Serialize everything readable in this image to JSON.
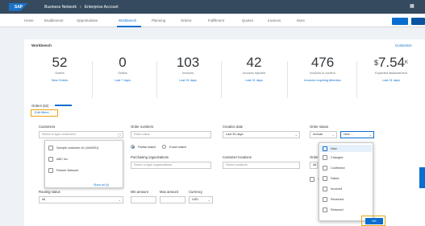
{
  "shell": {
    "logo": "SAP",
    "breadcrumbs": [
      "Business Network",
      "›",
      "Enterprise Account"
    ],
    "menu_icon": "grid-icon"
  },
  "nav": {
    "tabs": [
      "Home",
      "Enablement",
      "Opportunities",
      "Workbench",
      "Planning",
      "Orders",
      "Fulfillment",
      "Quotes",
      "Invoices",
      "More"
    ],
    "active_tab": "Workbench"
  },
  "card": {
    "title": "Workbench",
    "customize": "Customize",
    "kpis": [
      {
        "value": "52",
        "label": "Orders",
        "link": "New Orders"
      },
      {
        "value": "0",
        "label": "Orders",
        "link": "Last 7 days"
      },
      {
        "value": "103",
        "label": "Invoices",
        "link": "Last 31 days"
      },
      {
        "value": "42",
        "label": "Invoices rejected",
        "link": "Last 31 days"
      },
      {
        "value": "476",
        "label": "Invoices to confirm",
        "link": "Invoices requiring Attention"
      },
      {
        "value": "7.54",
        "label": "Expected disbursement",
        "link": "Last 31 days",
        "unit": "K",
        "prefix": "$"
      }
    ],
    "filters_head": "Orders (52)",
    "filters_chip": "Edit filters"
  },
  "form": {
    "customer": {
      "label": "Customers",
      "placeholder": "Select or type customers"
    },
    "customer_options": [
      "Sample customer A1 (AN0001)",
      "ABC Inc",
      "Partner Network"
    ],
    "show_all": "Show all (4)",
    "order_numbers": {
      "label": "Order numbers",
      "placeholder": "Exact value"
    },
    "match_exact": "Partial match",
    "exact_match": "Exact match",
    "creation_date": {
      "label": "Creation date",
      "value": "Last 30 days"
    },
    "order_status": {
      "label": "Order status",
      "value": "Include",
      "value2": "New",
      "value3": "…"
    },
    "purchasing_org": {
      "label": "Purchasing organizations",
      "placeholder": "Select or type organizations"
    },
    "customer_location": {
      "label": "Customer locations",
      "placeholder": "Select locations"
    },
    "order_type": {
      "label": "Order type",
      "value": "All"
    },
    "show_closed": "Show closed",
    "routing_status": {
      "label": "Routing status",
      "value": "All"
    },
    "min_amount": {
      "label": "Min amount"
    },
    "max_amount": {
      "label": "Max amount"
    },
    "currency": {
      "label": "Currency",
      "value": "USD"
    }
  },
  "status_list": [
    "New",
    "Changed",
    "Confirmed",
    "Failed",
    "Invoiced",
    "Received",
    "Returned"
  ],
  "ok_label": "OK"
}
